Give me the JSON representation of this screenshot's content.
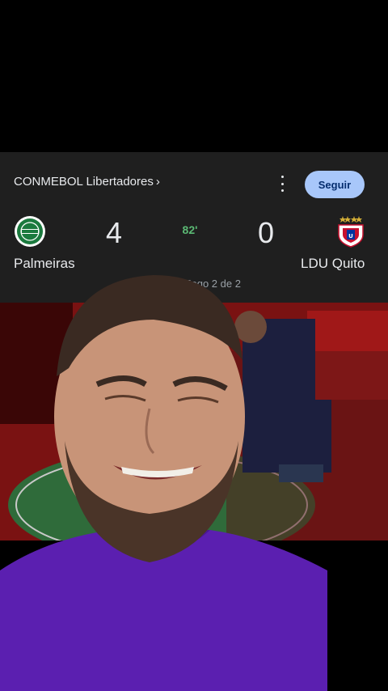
{
  "header": {
    "league_label": "CONMEBOL Libertadores",
    "league_chevron": "›",
    "follow_label": "Seguir"
  },
  "match": {
    "home": {
      "name": "Palmeiras",
      "score": "4"
    },
    "away": {
      "name": "LDU Quito",
      "score": "0"
    },
    "minute": "82'",
    "game_count": "Jogo 2 de 2"
  },
  "colors": {
    "card_bg": "#1f1f1f",
    "follow_bg": "#a8c7fa",
    "minute": "#5bb974",
    "shirt": "#5b1fb0"
  },
  "icons": {
    "home_crest": "palmeiras-crest-icon",
    "away_crest": "ldu-quito-crest-icon",
    "menu": "more-vert-icon"
  }
}
